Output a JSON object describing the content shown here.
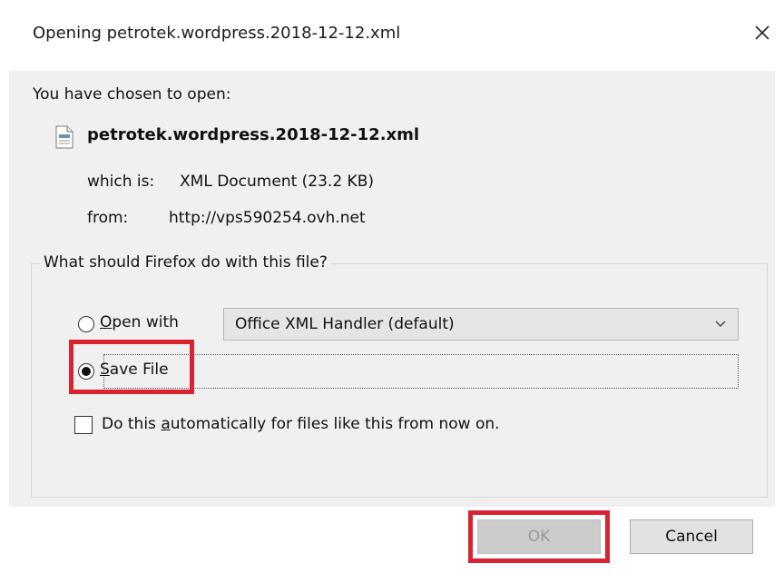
{
  "dialog": {
    "title": "Opening petrotek.wordpress.2018-12-12.xml",
    "intro": "You have chosen to open:",
    "file_name": "petrotek.wordpress.2018-12-12.xml",
    "which_is_label": "which is:",
    "which_is_value": "XML Document (23.2 KB)",
    "from_label": "from:",
    "from_value": "http://vps590254.ovh.net",
    "question": "What should Firefox do with this file?",
    "open_with": {
      "label_prefix": "",
      "label_access": "O",
      "label_rest": "pen with",
      "selected": false,
      "select_value": "Office XML Handler (default)"
    },
    "save_file": {
      "label_access": "S",
      "label_rest": "ave File",
      "selected": true
    },
    "auto_checkbox": {
      "label_prefix": "Do this ",
      "label_access": "a",
      "label_rest": "utomatically for files like this from now on.",
      "checked": false
    },
    "buttons": {
      "ok_label": "OK",
      "ok_disabled": true,
      "cancel_label": "Cancel"
    }
  },
  "icons": {
    "close": "close-icon",
    "file": "xml-file-icon",
    "dropdown": "chevron-down-icon"
  },
  "colors": {
    "highlight": "#d9242f",
    "content_bg": "#f0f0f0",
    "button_bg": "#e1e1e1"
  }
}
